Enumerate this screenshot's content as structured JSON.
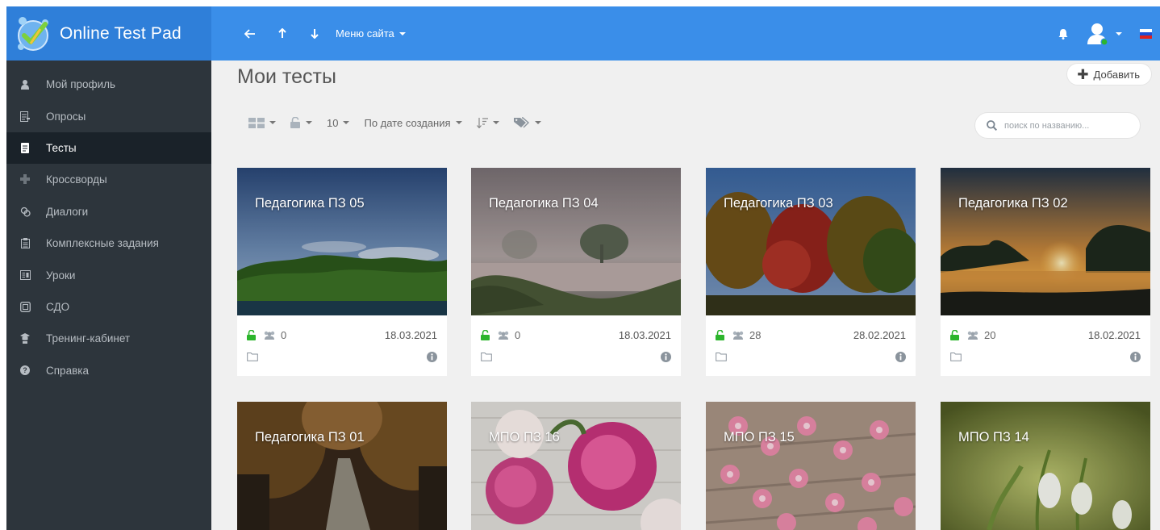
{
  "colors": {
    "topbar": "#3a8ee9",
    "sidebar": "#2d353c",
    "accent_green": "#2cb52c"
  },
  "app": {
    "name": "Online Test Pad"
  },
  "topbar": {
    "site_menu": "Меню сайта"
  },
  "sidebar": {
    "items": [
      {
        "label": "Мой профиль",
        "icon": "user-icon"
      },
      {
        "label": "Опросы",
        "icon": "poll-icon"
      },
      {
        "label": "Тесты",
        "icon": "test-icon",
        "active": true
      },
      {
        "label": "Кроссворды",
        "icon": "crossword-icon"
      },
      {
        "label": "Диалоги",
        "icon": "dialog-icon"
      },
      {
        "label": "Комплексные задания",
        "icon": "complex-task-icon"
      },
      {
        "label": "Уроки",
        "icon": "lesson-icon"
      },
      {
        "label": "СДО",
        "icon": "lms-icon"
      },
      {
        "label": "Тренинг-кабинет",
        "icon": "training-icon"
      },
      {
        "label": "Справка",
        "icon": "help-icon"
      }
    ]
  },
  "main": {
    "title": "Мои тесты",
    "add_label": "Добавить",
    "toolbar": {
      "page_size": "10",
      "sort_label": "По дате создания"
    },
    "search_placeholder": "поиск по названию..."
  },
  "cards": [
    {
      "title": "Педагогика ПЗ 05",
      "participants": "0",
      "date": "18.03.2021",
      "image": "lake-forest-blue-sky"
    },
    {
      "title": "Педагогика ПЗ 04",
      "participants": "0",
      "date": "18.03.2021",
      "image": "misty-river"
    },
    {
      "title": "Педагогика ПЗ 03",
      "participants": "28",
      "date": "28.02.2021",
      "image": "autumn-trees"
    },
    {
      "title": "Педагогика ПЗ 02",
      "participants": "20",
      "date": "18.02.2021",
      "image": "sunset-river"
    },
    {
      "title": "Педагогика ПЗ 01",
      "image": "autumn-road"
    },
    {
      "title": "МПО ПЗ 16",
      "image": "peonies"
    },
    {
      "title": "МПО ПЗ 15",
      "image": "pink-flowers"
    },
    {
      "title": "МПО ПЗ 14",
      "image": "snowdrops"
    }
  ]
}
